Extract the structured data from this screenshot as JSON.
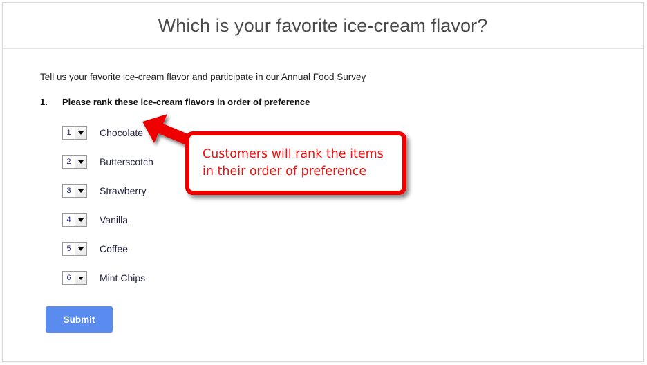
{
  "form": {
    "title": "Which is your favorite ice-cream flavor?",
    "description": "Tell us your favorite ice-cream flavor and participate in our Annual Food Survey",
    "question": {
      "number": "1.",
      "text": "Please rank these ice-cream flavors in order of preference"
    },
    "rank_items": [
      {
        "rank": "1",
        "flavor": "Chocolate"
      },
      {
        "rank": "2",
        "flavor": "Butterscotch"
      },
      {
        "rank": "3",
        "flavor": "Strawberry"
      },
      {
        "rank": "4",
        "flavor": "Vanilla"
      },
      {
        "rank": "5",
        "flavor": "Coffee"
      },
      {
        "rank": "6",
        "flavor": "Mint Chips"
      }
    ],
    "submit_label": "Submit"
  },
  "annotation": {
    "line1": "Customers will rank the items",
    "line2": "in their order of preference",
    "color": "#ee0000",
    "target": "Chocolate"
  },
  "colors": {
    "accent": "#5a8cf0",
    "annotation_red": "#ee0000",
    "title_gray": "#4a4a4a",
    "card_border": "#d9d9d9"
  }
}
